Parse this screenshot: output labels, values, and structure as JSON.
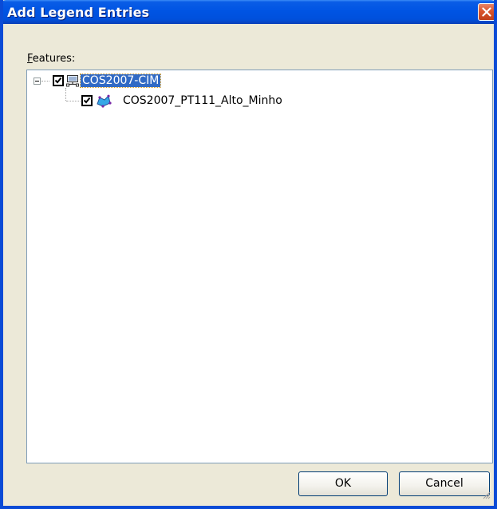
{
  "window": {
    "title": "Add Legend Entries"
  },
  "features": {
    "label_accel": "F",
    "label_rest": "eatures:"
  },
  "tree": {
    "nodes": [
      {
        "label": "COS2007-CIM",
        "checked": true,
        "selected": true,
        "expanded": true,
        "icon": "network-layer-icon"
      },
      {
        "label": "COS2007_PT111_Alto_Minho",
        "checked": true,
        "selected": false,
        "icon": "polygon-feature-icon"
      }
    ]
  },
  "buttons": {
    "ok_label": "OK",
    "cancel_label": "Cancel"
  },
  "colors": {
    "title_bar": "#0054e3",
    "selection": "#316ac5",
    "dialog_face": "#ece9d8",
    "close_button": "#d9542c"
  }
}
